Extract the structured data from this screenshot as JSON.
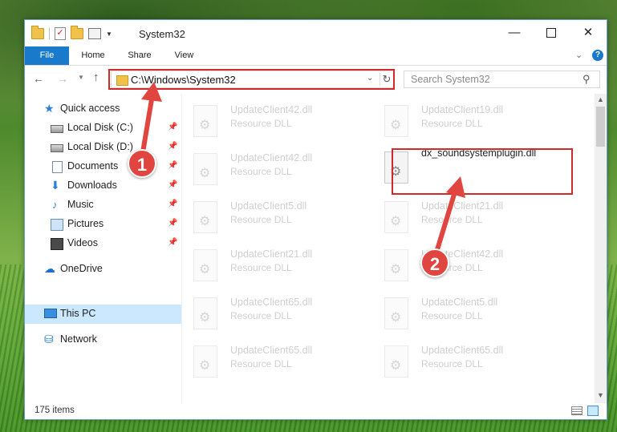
{
  "window": {
    "title": "System32",
    "controls": {
      "minimize": "—",
      "maximize": "",
      "close": "✕"
    }
  },
  "ribbon": {
    "tabs": [
      "File",
      "Home",
      "Share",
      "View"
    ],
    "accent": "#1979ca",
    "help": "?"
  },
  "navigation": {
    "address": "C:\\Windows\\System32",
    "search_placeholder": "Search System32"
  },
  "sidebar": {
    "items": [
      {
        "label": "Quick access",
        "icon": "star-icon"
      },
      {
        "label": "Local Disk (C:)",
        "icon": "drive-icon",
        "pinned": true
      },
      {
        "label": "Local Disk (D:)",
        "icon": "drive-icon",
        "pinned": true
      },
      {
        "label": "Documents",
        "icon": "document-icon",
        "pinned": true
      },
      {
        "label": "Downloads",
        "icon": "download-icon",
        "pinned": true
      },
      {
        "label": "Music",
        "icon": "music-icon",
        "pinned": true
      },
      {
        "label": "Pictures",
        "icon": "pictures-icon",
        "pinned": true
      },
      {
        "label": "Videos",
        "icon": "video-icon",
        "pinned": true
      },
      {
        "label": "OneDrive",
        "icon": "cloud-icon"
      },
      {
        "label": "This PC",
        "icon": "computer-icon",
        "selected": true
      },
      {
        "label": "Network",
        "icon": "network-icon"
      }
    ]
  },
  "files": [
    {
      "name": "UpdateClient42.dll",
      "type": "Resource DLL"
    },
    {
      "name": "UpdateClient19.dll",
      "type": "Resource DLL"
    },
    {
      "name": "UpdateClient42.dll",
      "type": "Resource DLL"
    },
    {
      "name": "dx_soundsystemplugin.dll",
      "type": ""
    },
    {
      "name": "UpdateClient5.dll",
      "type": "Resource DLL"
    },
    {
      "name": "UpdateClient21.dll",
      "type": "Resource DLL"
    },
    {
      "name": "UpdateClient21.dll",
      "type": "Resource DLL"
    },
    {
      "name": "UpdateClient42.dll",
      "type": "Resource DLL"
    },
    {
      "name": "UpdateClient65.dll",
      "type": "Resource DLL"
    },
    {
      "name": "UpdateClient5.dll",
      "type": "Resource DLL"
    },
    {
      "name": "UpdateClient65.dll",
      "type": "Resource DLL"
    },
    {
      "name": "UpdateClient65.dll",
      "type": "Resource DLL"
    }
  ],
  "status": {
    "item_count": "175 items"
  },
  "annotations": {
    "step1": "1",
    "step2": "2",
    "color": "#e0453f"
  }
}
